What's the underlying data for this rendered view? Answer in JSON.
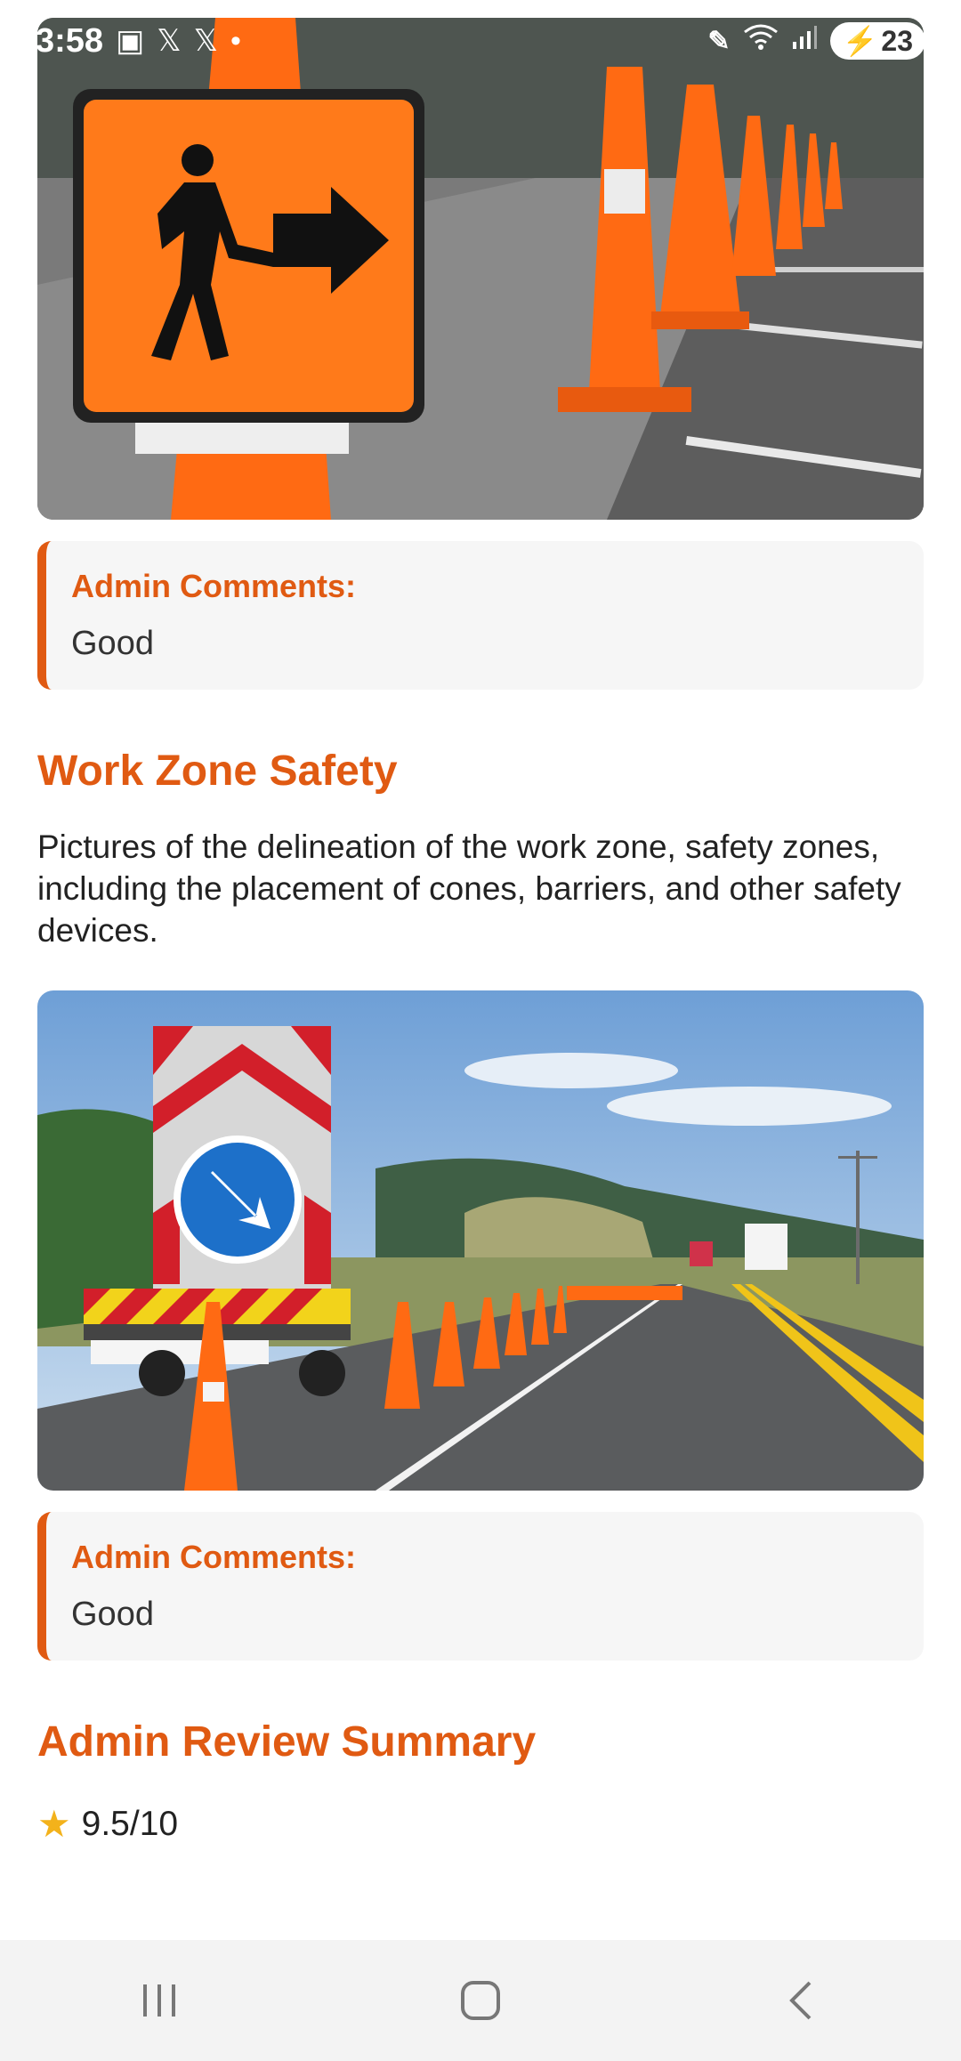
{
  "status": {
    "time": "3:58",
    "battery": "23"
  },
  "items": [
    {
      "image_alt": "Orange pedestrian sign with cones",
      "comment_label": "Admin Comments:",
      "comment_value": "Good"
    }
  ],
  "section": {
    "title": "Work Zone Safety",
    "description": "Pictures of the delineation of the work zone, safety zones, including the placement of cones, barriers, and other safety devices.",
    "image_alt": "Roadwork truck with cones on road",
    "comment_label": "Admin Comments:",
    "comment_value": "Good"
  },
  "summary": {
    "title": "Admin Review Summary",
    "rating": "9.5/10"
  },
  "nav": {
    "recent": "recents-icon",
    "home": "home-icon",
    "back": "back-icon"
  },
  "colors": {
    "accent": "#e05a12"
  }
}
